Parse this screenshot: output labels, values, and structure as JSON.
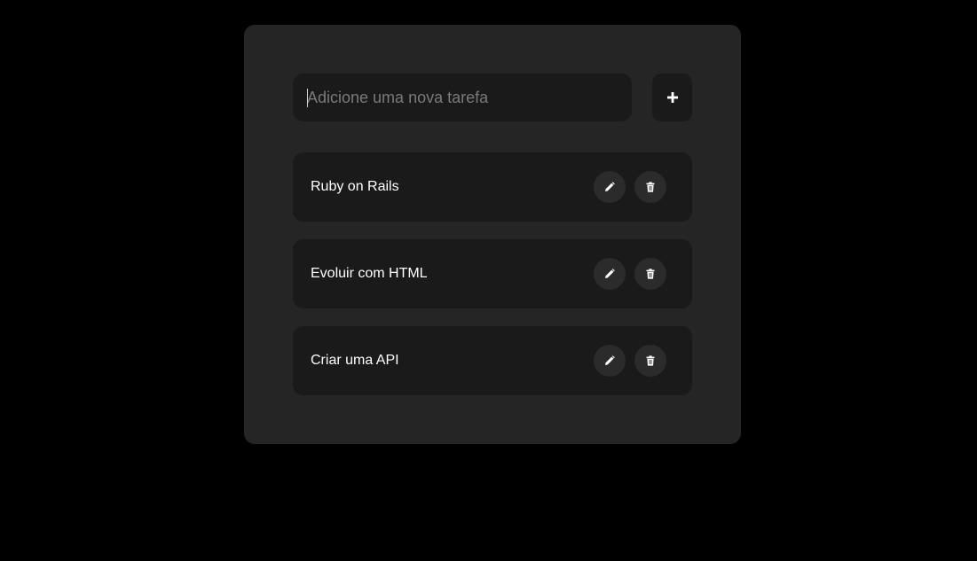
{
  "new_task": {
    "placeholder": "Adicione uma nova tarefa",
    "value": "",
    "add_icon": "plus-icon"
  },
  "tasks": [
    {
      "label": "Ruby on Rails",
      "edit_icon": "pencil-icon",
      "delete_icon": "trash-icon"
    },
    {
      "label": "Evoluir com HTML",
      "edit_icon": "pencil-icon",
      "delete_icon": "trash-icon"
    },
    {
      "label": "Criar uma API",
      "edit_icon": "pencil-icon",
      "delete_icon": "trash-icon"
    }
  ],
  "colors": {
    "page_background": "#000000",
    "card_background": "#252525",
    "field_background": "#1a1a1a",
    "icon_button_background": "#2b2b2b",
    "text": "#ffffff",
    "placeholder": "#7a7a7a"
  }
}
